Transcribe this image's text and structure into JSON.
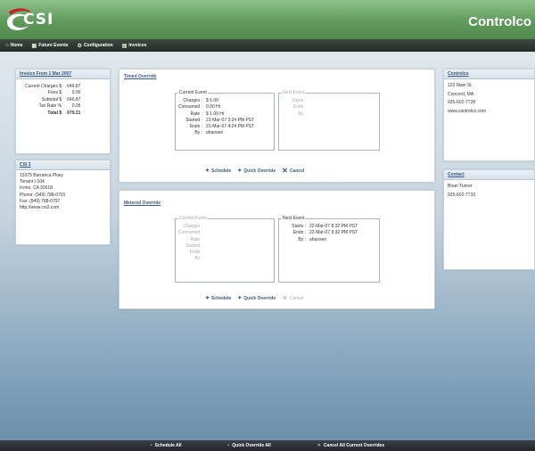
{
  "header": {
    "logo_text": "CSI",
    "app_title": "Controlco"
  },
  "nav": {
    "items": [
      {
        "label": "Home",
        "icon": "house-icon"
      },
      {
        "label": "Future Events",
        "icon": "calendar-icon"
      },
      {
        "label": "Configuration",
        "icon": "gear-icon"
      },
      {
        "label": "Invoices",
        "icon": "document-icon"
      }
    ]
  },
  "invoice": {
    "title": "Invoice From 1 Mar 2007",
    "rows": [
      {
        "label": "Current Charges $",
        "value": "646.87"
      },
      {
        "label": "Fees $",
        "value": "0.00"
      },
      {
        "label": "Subtotal $",
        "value": "646.87"
      },
      {
        "label": "Tax Rate %",
        "value": "0.05"
      },
      {
        "label": "Total $",
        "value": "679.21"
      }
    ]
  },
  "csi_info": {
    "title": "CSI 3",
    "lines": [
      "15375 Barranca Pkwy",
      "Tenant I-104",
      "Irvine, CA 92618",
      "Phone: (949) 788-0701",
      "Fax: (949) 788-0797",
      "http://www.csi3.com"
    ]
  },
  "timed_override": {
    "title": "Timed Override",
    "current_event": {
      "legend": "Current Event",
      "rows": [
        {
          "label": "Charges :",
          "value": "$ 5.00"
        },
        {
          "label": "Consumed :",
          "value": "0.00 Hr"
        },
        {
          "label": "Rate :",
          "value": "$ 1.00 Hr"
        },
        {
          "label": "Started :",
          "value": "21-Mar-07 3:24 PM PST"
        },
        {
          "label": "Ends :",
          "value": "21-Mar-07 4:24 PM PST"
        },
        {
          "label": "By :",
          "value": "ahansen"
        }
      ]
    },
    "next_event": {
      "legend": "Next Event",
      "rows": [
        {
          "label": "Starts :",
          "value": ""
        },
        {
          "label": "Ends :",
          "value": ""
        },
        {
          "label": "By :",
          "value": ""
        }
      ]
    },
    "actions": {
      "schedule": "Schedule",
      "quick_override": "Quick Override",
      "cancel": "Cancel"
    }
  },
  "metered_override": {
    "title": "Metered Override",
    "current_event": {
      "legend": "Current Event",
      "rows": [
        {
          "label": "Charges :",
          "value": ""
        },
        {
          "label": "Consumed :",
          "value": ""
        },
        {
          "label": "Rate :",
          "value": ""
        },
        {
          "label": "Started :",
          "value": ""
        },
        {
          "label": "Ends :",
          "value": ""
        },
        {
          "label": "By :",
          "value": ""
        }
      ]
    },
    "next_event": {
      "legend": "Next Event",
      "rows": [
        {
          "label": "Starts :",
          "value": "22-Mar-07 8:32 PM PST"
        },
        {
          "label": "Ends :",
          "value": "22-Mar-07 9:32 PM PST"
        },
        {
          "label": "By :",
          "value": "ahansen"
        }
      ]
    },
    "actions": {
      "schedule": "Schedule",
      "quick_override": "Quick Override",
      "cancel": "Cancel"
    }
  },
  "controlco": {
    "title": "Controlco",
    "lines": [
      "123 Main St",
      "Concord, MA",
      "925-602-7728",
      "www.controlco.com"
    ]
  },
  "contact": {
    "title": "Contact",
    "lines": [
      "Brian Turner",
      "925-602-7733"
    ]
  },
  "footer": {
    "items": [
      "Schedule All",
      "Quick Override All",
      "Cancel All Current Overrides"
    ]
  },
  "colors": {
    "header_green": "#5f9a5c",
    "nav_dark": "#2f3631",
    "link_blue": "#3c5a82",
    "logo_red": "#c8202a"
  }
}
